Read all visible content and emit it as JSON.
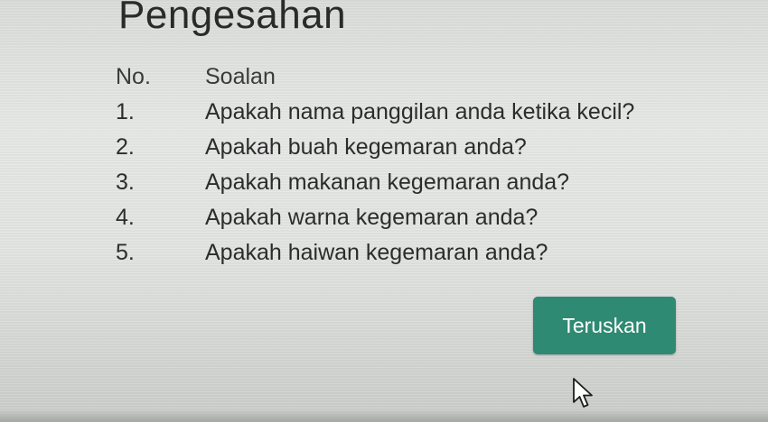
{
  "page": {
    "title": "Pengesahan"
  },
  "table": {
    "headers": {
      "no": "No.",
      "question": "Soalan"
    },
    "rows": [
      {
        "no": "1.",
        "question": "Apakah nama panggilan anda ketika kecil?"
      },
      {
        "no": "2.",
        "question": "Apakah buah kegemaran anda?"
      },
      {
        "no": "3.",
        "question": "Apakah makanan kegemaran anda?"
      },
      {
        "no": "4.",
        "question": "Apakah warna kegemaran anda?"
      },
      {
        "no": "5.",
        "question": "Apakah haiwan kegemaran anda?"
      }
    ]
  },
  "actions": {
    "continue_label": "Teruskan"
  },
  "colors": {
    "accent": "#2e8a72",
    "text": "#2c2c2c",
    "background": "#e4e6e4"
  },
  "icons": {
    "cursor": "mouse-pointer-icon"
  }
}
